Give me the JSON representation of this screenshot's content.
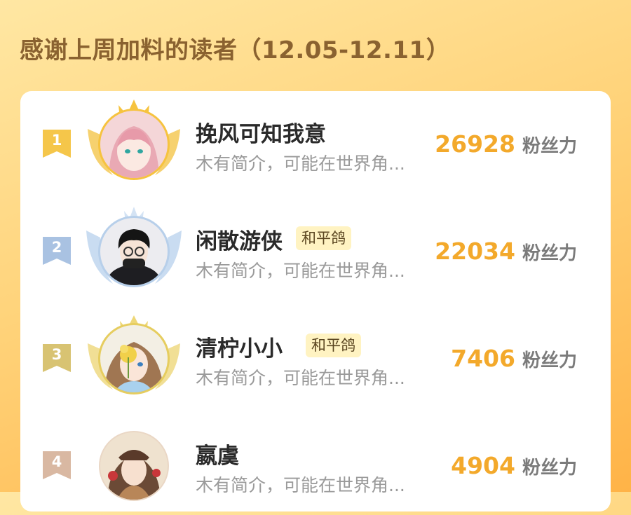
{
  "page": {
    "title": "感谢上周加料的读者（12.05-12.11）"
  },
  "readers": [
    {
      "rank": "1",
      "name": "挽风可知我意",
      "tag": "",
      "intro": "木有简介，可能在世界角...",
      "score": "26928",
      "unit": "粉丝力",
      "badge_color": "#f5c64a",
      "frame_color": "#f6c33f"
    },
    {
      "rank": "2",
      "name": "闲散游侠",
      "tag": "和平鸽",
      "intro": "木有简介，可能在世界角...",
      "score": "22034",
      "unit": "粉丝力",
      "badge_color": "#a9c2e2",
      "frame_color": "#b7cfea"
    },
    {
      "rank": "3",
      "name": "清柠小小",
      "tag": "和平鸽",
      "intro": "木有简介，可能在世界角...",
      "score": "7406",
      "unit": "粉丝力",
      "badge_color": "#d8c372",
      "frame_color": "#e6cd5f"
    },
    {
      "rank": "4",
      "name": "嬴虞",
      "tag": "",
      "intro": "木有简介，可能在世界角...",
      "score": "4904",
      "unit": "粉丝力",
      "badge_color": "#d9b8a2",
      "frame_color": "#ead7c5"
    }
  ],
  "icons": [
    "rank-ribbon-icon",
    "crown-icon",
    "wings-icon",
    "avatar-image"
  ]
}
